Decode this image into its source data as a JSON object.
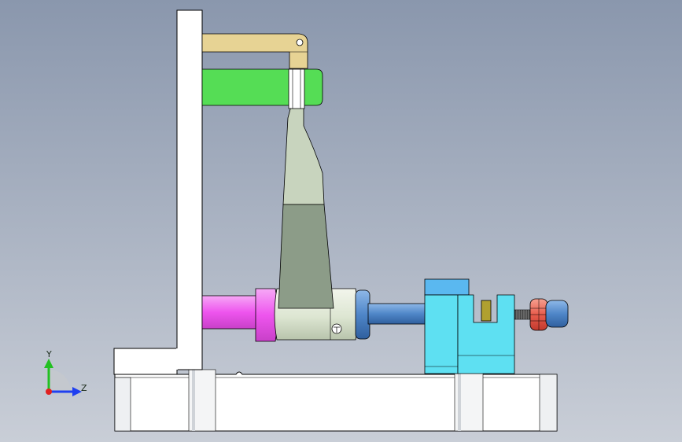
{
  "viewport": {
    "background_top": "#8a97ad",
    "background_bottom": "#c9ced7"
  },
  "axis_triad": {
    "y_label": "Y",
    "z_label": "Z",
    "y_color": "#22c022",
    "z_color": "#1f3ff0",
    "origin_color": "#e02020"
  },
  "part_colors": {
    "frame": "#ffffff",
    "link": "#e6d08e",
    "green_block": "#55dd55",
    "arm_top": "#d8e0cc",
    "arm_bottom": "#8a9a86",
    "pink_rod": "#ee66ee",
    "blue_rod": "#5a8fd0",
    "cyan_block": "#55ddee",
    "olive_pin": "#a8a030",
    "red_nut": "#ee6655"
  }
}
